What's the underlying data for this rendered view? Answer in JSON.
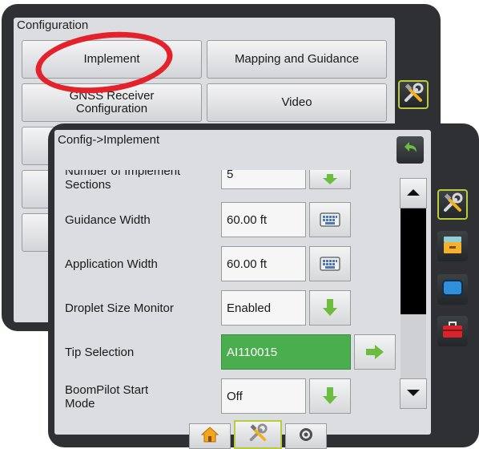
{
  "config_screen": {
    "title": "Configuration",
    "buttons": [
      {
        "label": "Implement"
      },
      {
        "label": "Mapping and Guidance"
      },
      {
        "label": "GNSS Receiver Configuration"
      },
      {
        "label": "Video"
      }
    ]
  },
  "implement_screen": {
    "title": "Config->Implement",
    "rows": [
      {
        "label": "Number of Implement Sections",
        "value": "5",
        "control": "arrow-down-icon"
      },
      {
        "label": "Guidance Width",
        "value": "60.00 ft",
        "control": "keyboard-icon"
      },
      {
        "label": "Application Width",
        "value": "60.00 ft",
        "control": "keyboard-icon"
      },
      {
        "label": "Droplet Size Monitor",
        "value": "Enabled",
        "control": "arrow-down-icon"
      },
      {
        "label": "Tip Selection",
        "value": "AI110015",
        "control": "arrow-right-icon"
      },
      {
        "label": "BoomPilot Start Mode",
        "value": "Off",
        "control": "arrow-down-icon"
      }
    ]
  },
  "side_tabs": [
    "tools-icon",
    "console-icon",
    "display-icon",
    "toolbox-icon"
  ],
  "bottom_tabs": [
    "home-icon",
    "tools-icon",
    "gear-icon"
  ],
  "colors": {
    "panel": "#2e3033",
    "content": "#dcdde0",
    "selected_field": "#4aad4e",
    "green_arrow": "#6cbd3f",
    "accent_border": "#b9cc3b",
    "annotation": "#e4222c"
  }
}
